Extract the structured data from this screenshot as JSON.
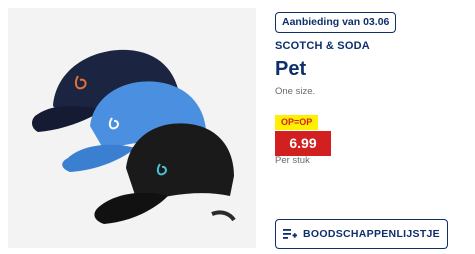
{
  "product": {
    "badge": "Aanbieding van 03.06",
    "brand": "SCOTCH & SODA",
    "title": "Pet",
    "size_note": "One size.",
    "sale_label": "OP=OP",
    "price": "6.99",
    "unit": "Per stuk",
    "image_icon": "cap-photo"
  },
  "actions": {
    "list_button_label": "BOODSCHAPPENLIJSTJE",
    "list_icon": "list-add-icon"
  },
  "colors": {
    "brand_blue": "#0f2f6b",
    "sale_red": "#d21f1f",
    "sale_yellow": "#fff000"
  }
}
